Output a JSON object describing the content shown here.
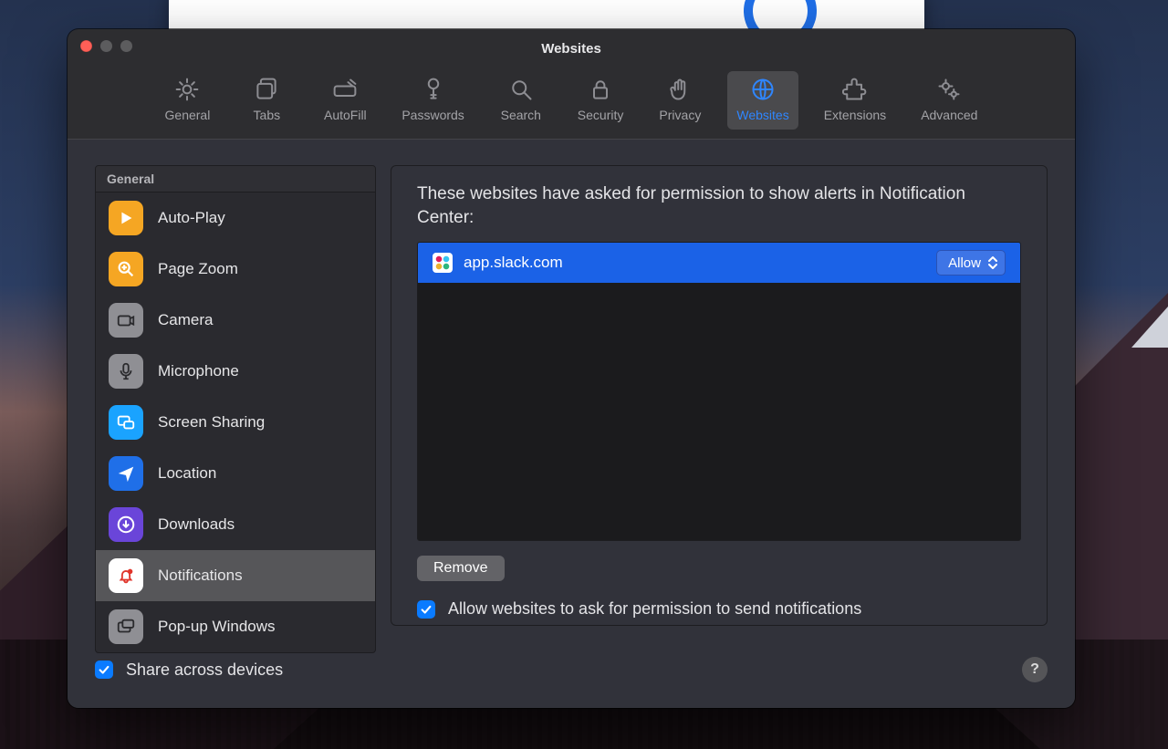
{
  "window": {
    "title": "Websites"
  },
  "toolbar": {
    "general": "General",
    "tabs": "Tabs",
    "autofill": "AutoFill",
    "passwords": "Passwords",
    "search": "Search",
    "security": "Security",
    "privacy": "Privacy",
    "websites": "Websites",
    "extensions": "Extensions",
    "advanced": "Advanced",
    "active": "websites"
  },
  "sidebar": {
    "section": "General",
    "items": [
      {
        "id": "autoplay",
        "label": "Auto-Play",
        "icon": "play",
        "color": "#f5a623"
      },
      {
        "id": "pagezoom",
        "label": "Page Zoom",
        "icon": "zoom",
        "color": "#f5a623"
      },
      {
        "id": "camera",
        "label": "Camera",
        "icon": "camera",
        "color": "#8f8f94"
      },
      {
        "id": "microphone",
        "label": "Microphone",
        "icon": "mic",
        "color": "#8f8f94"
      },
      {
        "id": "screensharing",
        "label": "Screen Sharing",
        "icon": "screenshare",
        "color": "#1aa3ff"
      },
      {
        "id": "location",
        "label": "Location",
        "icon": "location",
        "color": "#1f6fe8"
      },
      {
        "id": "downloads",
        "label": "Downloads",
        "icon": "download",
        "color": "#6a45d9"
      },
      {
        "id": "notifications",
        "label": "Notifications",
        "icon": "bell",
        "color": "#ffffff",
        "selected": true
      },
      {
        "id": "popups",
        "label": "Pop-up Windows",
        "icon": "popup",
        "color": "#8f8f94"
      }
    ]
  },
  "content": {
    "heading": "These websites have asked for permission to show alerts in Notification Center:",
    "sites": [
      {
        "domain": "app.slack.com",
        "favicon": "slack",
        "permission": "Allow"
      }
    ],
    "remove_label": "Remove",
    "ask_checkbox": {
      "checked": true,
      "label": "Allow websites to ask for permission to send notifications"
    }
  },
  "footer": {
    "share_checkbox": {
      "checked": true,
      "label": "Share across devices"
    },
    "help": "?"
  }
}
